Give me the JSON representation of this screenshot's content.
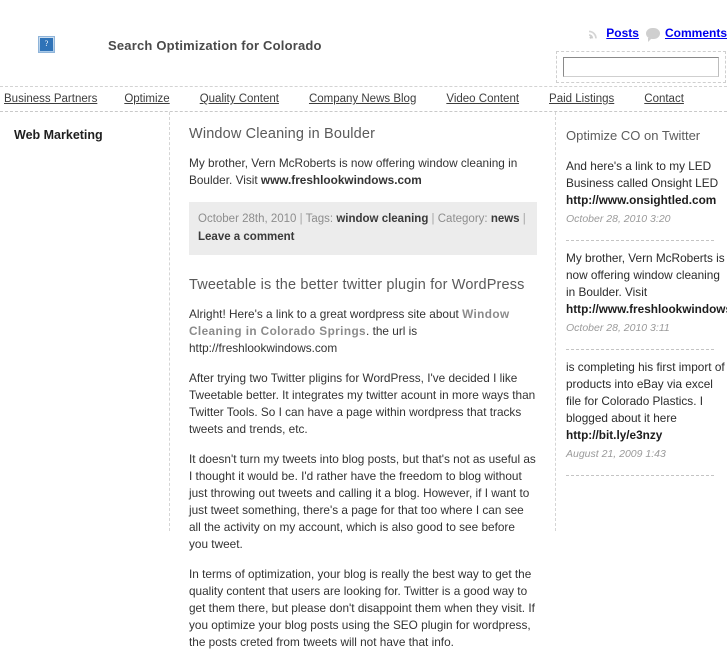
{
  "header": {
    "site_title": "Search Optimization for Colorado",
    "logo_icon": "broken-image-icon",
    "logo_glyph": "?",
    "feeds": [
      {
        "icon": "rss-icon",
        "label": "Posts"
      },
      {
        "icon": "comment-bubble-icon",
        "label": "Comments"
      }
    ],
    "search": {
      "value": "",
      "placeholder": ""
    }
  },
  "nav": {
    "items": [
      {
        "label": "Business Partners"
      },
      {
        "label": "Optimize"
      },
      {
        "label": "Quality Content"
      },
      {
        "label": "Company News Blog"
      },
      {
        "label": "Video Content"
      },
      {
        "label": "Paid Listings"
      },
      {
        "label": "Contact"
      }
    ]
  },
  "left_sidebar": {
    "widget_title": "Web Marketing"
  },
  "main": {
    "posts": [
      {
        "title": "Window Cleaning in Boulder",
        "paragraph_lead": "My brother, Vern McRoberts is now offering window cleaning in Boulder. Visit ",
        "paragraph_link": "www.freshlookwindows.com",
        "meta": {
          "date": "October 28th, 2010",
          "tags_label": "Tags:",
          "tags_value": "window cleaning",
          "category_label": "Category:",
          "category_value": "news",
          "comment_link": "Leave a comment"
        }
      },
      {
        "title": "Tweetable is the better twitter plugin for WordPress",
        "p1_before": "Alright! Here's a link to a great wordpress site about ",
        "p1_link": "Window Cleaning in Colorado Springs",
        "p1_after": ". the url is http://freshlookwindows.com",
        "p2": "After trying two Twitter pligins for WordPress, I've decided I like Tweetable better.  It integrates my twitter acount in more ways than Twitter Tools.  So I can have a page within wordpress that tracks tweets and trends, etc.",
        "p3": "It doesn't turn my tweets into blog posts, but that's not as useful as I thought it would be.  I'd rather have the freedom to blog without just throwing out tweets and calling it a blog.  However, if I want to just tweet something, there's a page for that too where I can see all the activity on my account, which is also good to see before you tweet.",
        "p4": "In terms of optimization, your blog is really the best way to get the quality content that users are looking for.  Twitter is a good way to get them there, but please don't disappoint them when they visit.  If you optimize your blog posts using the SEO plugin for wordpress, the posts creted from tweets will not have that info."
      }
    ]
  },
  "right_sidebar": {
    "widget_title": "Optimize CO on Twitter",
    "tweets": [
      {
        "text": "And here's a link to my LED Business called Onsight LED ",
        "link": "http://www.onsightled.com",
        "time": "October 28, 2010 3:20"
      },
      {
        "text": "My brother, Vern McRoberts is now offering window cleaning in Boulder. Visit ",
        "link": "http://www.freshlookwindows.com/boulder-window-cleaning",
        "time": "October 28, 2010 3:11"
      },
      {
        "text": "is completing his first import of products into eBay via excel file for Colorado Plastics. I blogged about it here ",
        "link": "http://bit.ly/e3nzy",
        "time": "August 21, 2009 1:43"
      }
    ]
  },
  "colors": {
    "page_bg": "#ffffff",
    "text": "#333333",
    "muted": "#8d8d8d",
    "meta_bg": "#ececec",
    "dashed_border": "#d3d3d3",
    "logo_blue": "#2f73b8"
  }
}
